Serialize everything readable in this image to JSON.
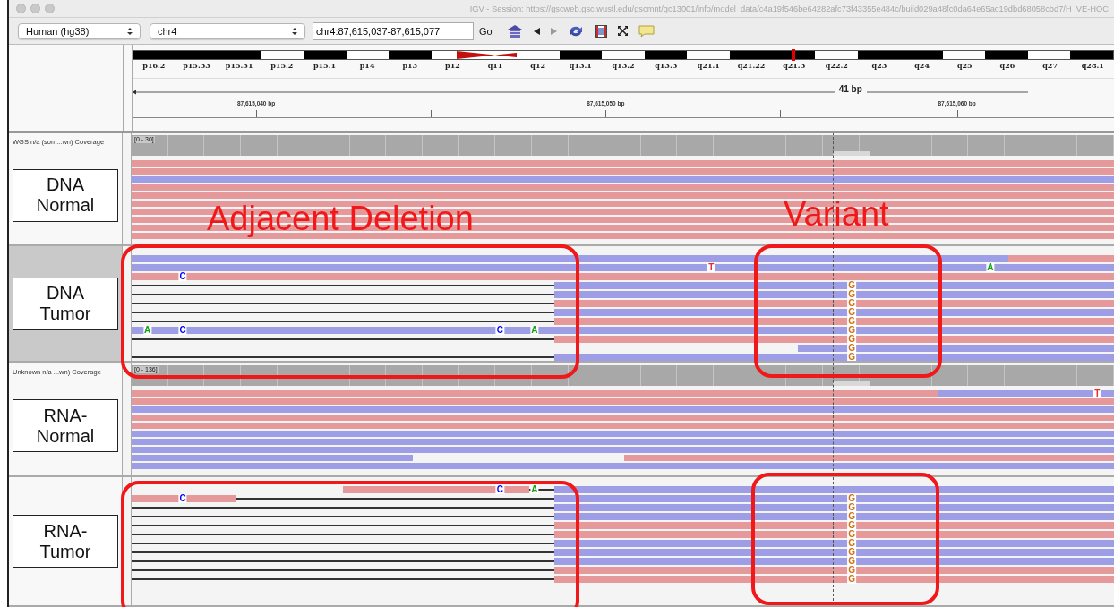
{
  "window": {
    "title": "IGV - Session: https://gscweb.gsc.wustl.edu/gscmnt/gc13001/info/model_data/c4a19f546be64282afc73f43355e484c/build029a48fc0da64e65ac19dbd68058cbd7/H_VE-HOC"
  },
  "toolbar": {
    "genome": "Human (hg38)",
    "chromosome": "chr4",
    "locus": "chr4:87,615,037-87,615,077",
    "go": "Go"
  },
  "ideogram": {
    "bands": [
      {
        "label": "p16.2",
        "kind": "dark",
        "current": false
      },
      {
        "label": "p15.33",
        "kind": "dark",
        "current": false
      },
      {
        "label": "p15.31",
        "kind": "dark",
        "current": false
      },
      {
        "label": "p15.2",
        "kind": "light",
        "current": false
      },
      {
        "label": "p15.1",
        "kind": "dark",
        "current": false
      },
      {
        "label": "p14",
        "kind": "light",
        "current": false
      },
      {
        "label": "p13",
        "kind": "dark",
        "current": false
      },
      {
        "label": "p12",
        "kind": "light",
        "current": false
      },
      {
        "label": "q11",
        "kind": "centromere",
        "current": false
      },
      {
        "label": "q12",
        "kind": "light",
        "current": false
      },
      {
        "label": "q13.1",
        "kind": "dark",
        "current": false
      },
      {
        "label": "q13.2",
        "kind": "light",
        "current": false
      },
      {
        "label": "q13.3",
        "kind": "dark",
        "current": false
      },
      {
        "label": "q21.1",
        "kind": "light",
        "current": false
      },
      {
        "label": "q21.22",
        "kind": "dark",
        "current": false
      },
      {
        "label": "q21.3",
        "kind": "dark",
        "current": true
      },
      {
        "label": "q22.2",
        "kind": "light",
        "current": false
      },
      {
        "label": "q23",
        "kind": "dark",
        "current": false
      },
      {
        "label": "q24",
        "kind": "dark",
        "current": false
      },
      {
        "label": "q25",
        "kind": "light",
        "current": false
      },
      {
        "label": "q26",
        "kind": "dark",
        "current": false
      },
      {
        "label": "q27",
        "kind": "light",
        "current": false
      },
      {
        "label": "q28.1",
        "kind": "dark",
        "current": false
      }
    ]
  },
  "ruler": {
    "span": "41 bp",
    "ticks": [
      "87,615,040 bp",
      "87,615,050 bp",
      "87,615,060 bp"
    ]
  },
  "panels": [
    {
      "label": "DNA Normal",
      "selected": false,
      "coverage": {
        "name": "WGS n/a (som...wn) Coverage",
        "range": "[0 - 30]"
      },
      "reads": [
        {
          "reverse": false,
          "kind": "full"
        },
        {
          "reverse": false,
          "kind": "full"
        },
        {
          "reverse": true,
          "kind": "full"
        },
        {
          "reverse": false,
          "kind": "full"
        },
        {
          "reverse": false,
          "kind": "full"
        },
        {
          "reverse": false,
          "kind": "full"
        },
        {
          "reverse": false,
          "kind": "full"
        },
        {
          "reverse": false,
          "kind": "full"
        },
        {
          "reverse": false,
          "kind": "full"
        },
        {
          "reverse": false,
          "kind": "full"
        }
      ]
    },
    {
      "label": "DNA Tumor",
      "selected": true,
      "reads": [
        {
          "reverse": true,
          "kind": "tail-far"
        },
        {
          "reverse": true,
          "kind": "full",
          "mismatches": [
            {
              "base": "T",
              "kind": "mid-t",
              "color": "#e03030"
            },
            {
              "base": "A",
              "kind": "right-g",
              "color": "#10a010"
            }
          ]
        },
        {
          "reverse": false,
          "kind": "full",
          "mismatches": [
            {
              "base": "C",
              "kind": "left-c",
              "color": "#0000ff"
            }
          ]
        },
        {
          "reverse": true,
          "kind": "split",
          "mismatches": [
            {
              "base": "G",
              "kind": "variant",
              "color": "#d07010"
            }
          ]
        },
        {
          "reverse": true,
          "kind": "split",
          "mismatches": [
            {
              "base": "G",
              "kind": "variant",
              "color": "#d07010"
            }
          ]
        },
        {
          "reverse": false,
          "kind": "split",
          "mismatches": [
            {
              "base": "G",
              "kind": "variant",
              "color": "#d07010"
            }
          ]
        },
        {
          "reverse": true,
          "kind": "split",
          "mismatches": [
            {
              "base": "G",
              "kind": "variant",
              "color": "#d07010"
            }
          ]
        },
        {
          "reverse": false,
          "kind": "split",
          "mismatches": [
            {
              "base": "G",
              "kind": "variant",
              "color": "#d07010"
            }
          ]
        },
        {
          "reverse": true,
          "kind": "full",
          "mismatches": [
            {
              "base": "A",
              "kind": "left-a",
              "color": "#10a010"
            },
            {
              "base": "C",
              "kind": "left-c",
              "color": "#0000ff"
            },
            {
              "base": "C",
              "kind": "mid-c",
              "color": "#0000ff"
            },
            {
              "base": "A",
              "kind": "mid-a",
              "color": "#10a010"
            },
            {
              "base": "G",
              "kind": "variant",
              "color": "#d07010"
            }
          ]
        },
        {
          "reverse": false,
          "kind": "split",
          "mismatches": [
            {
              "base": "G",
              "kind": "variant",
              "color": "#d07010"
            }
          ]
        },
        {
          "reverse": true,
          "kind": "right-only",
          "mismatches": [
            {
              "base": "G",
              "kind": "variant",
              "color": "#d07010"
            }
          ]
        },
        {
          "reverse": true,
          "kind": "split",
          "mismatches": [
            {
              "base": "G",
              "kind": "variant",
              "color": "#d07010"
            }
          ]
        }
      ]
    },
    {
      "label": "RNA-Normal",
      "selected": false,
      "coverage": {
        "name": "Unknown n/a ...wn) Coverage",
        "range": "[0 - 136]"
      },
      "reads": [
        {
          "reverse": false,
          "kind": "tail-near",
          "mismatches": [
            {
              "base": "T",
              "kind": "far-right",
              "color": "#e03030"
            }
          ]
        },
        {
          "reverse": false,
          "kind": "full"
        },
        {
          "reverse": true,
          "kind": "full"
        },
        {
          "reverse": false,
          "kind": "full"
        },
        {
          "reverse": false,
          "kind": "full"
        },
        {
          "reverse": true,
          "kind": "full"
        },
        {
          "reverse": true,
          "kind": "full"
        },
        {
          "reverse": true,
          "kind": "full"
        },
        {
          "reverse": true,
          "kind": "gap"
        },
        {
          "reverse": true,
          "kind": "full"
        }
      ]
    },
    {
      "label": "RNA-Tumor",
      "selected": false,
      "reads": [
        {
          "reverse": false,
          "kind": "fragment-mid",
          "mismatches": [
            {
              "base": "C",
              "kind": "mid-c",
              "color": "#0000ff"
            },
            {
              "base": "A",
              "kind": "mid-a",
              "color": "#10a010"
            }
          ]
        },
        {
          "reverse": false,
          "kind": "fragment-left",
          "mismatches": [
            {
              "base": "C",
              "kind": "left-c",
              "color": "#0000ff"
            },
            {
              "base": "G",
              "kind": "variant",
              "color": "#d07010"
            }
          ]
        },
        {
          "reverse": true,
          "kind": "split",
          "mismatches": [
            {
              "base": "G",
              "kind": "variant",
              "color": "#d07010"
            }
          ]
        },
        {
          "reverse": true,
          "kind": "split",
          "mismatches": [
            {
              "base": "G",
              "kind": "variant",
              "color": "#d07010"
            }
          ]
        },
        {
          "reverse": false,
          "kind": "split",
          "mismatches": [
            {
              "base": "G",
              "kind": "variant",
              "color": "#d07010"
            }
          ]
        },
        {
          "reverse": false,
          "kind": "split",
          "mismatches": [
            {
              "base": "G",
              "kind": "variant",
              "color": "#d07010"
            }
          ]
        },
        {
          "reverse": true,
          "kind": "split",
          "mismatches": [
            {
              "base": "G",
              "kind": "variant",
              "color": "#d07010"
            }
          ]
        },
        {
          "reverse": true,
          "kind": "split",
          "mismatches": [
            {
              "base": "G",
              "kind": "variant",
              "color": "#d07010"
            }
          ]
        },
        {
          "reverse": true,
          "kind": "split",
          "mismatches": [
            {
              "base": "G",
              "kind": "variant",
              "color": "#d07010"
            }
          ]
        },
        {
          "reverse": false,
          "kind": "split",
          "mismatches": [
            {
              "base": "G",
              "kind": "variant",
              "color": "#d07010"
            }
          ]
        },
        {
          "reverse": false,
          "kind": "split",
          "mismatches": [
            {
              "base": "G",
              "kind": "variant",
              "color": "#d07010"
            }
          ]
        }
      ]
    }
  ],
  "annotations": [
    "Adjacent Deletion",
    "Variant"
  ]
}
